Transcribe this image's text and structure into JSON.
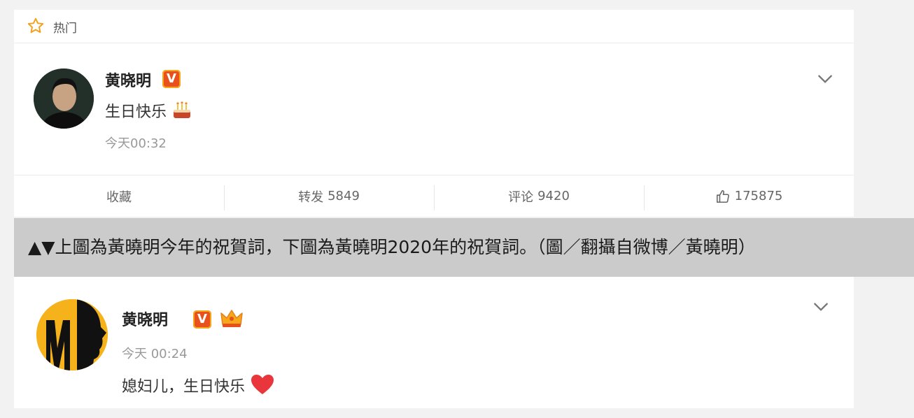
{
  "post1": {
    "section_label": "热门",
    "author_name": "黄晓明",
    "verified_badge": "V",
    "text": "生日快乐",
    "emoji": "cake-emoji",
    "time": "今天00:32",
    "actions": {
      "favorite": "收藏",
      "repost_label": "转发",
      "repost_count": "5849",
      "comment_label": "评论",
      "comment_count": "9420",
      "like_count": "175875"
    }
  },
  "caption": {
    "text": "▲▼上圖為黃曉明今年的祝賀詞，下圖為黃曉明2020年的祝賀詞。（圖／翻攝自微博／黃曉明）"
  },
  "post2": {
    "author_name": "黄晓明",
    "verified_badge": "V",
    "time": "今天 00:24",
    "text": "媳妇儿，生日快乐",
    "emoji": "heart-emoji"
  },
  "colors": {
    "badge_orange": "#e8501c",
    "star_orange": "#f7a71b",
    "avatar2_yellow": "#f6b21b",
    "heart_red": "#e8363c"
  }
}
